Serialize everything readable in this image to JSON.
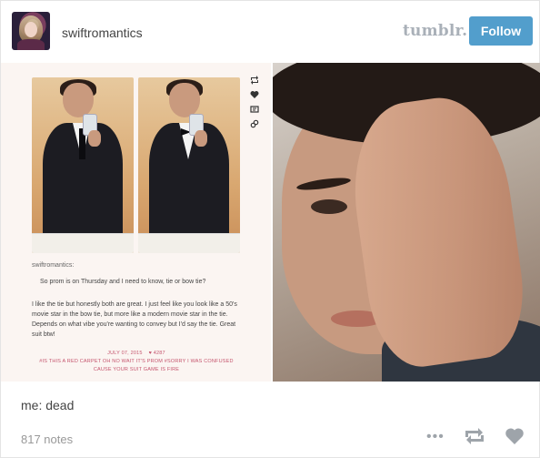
{
  "header": {
    "blog_name": "swiftromantics",
    "logo_text": "tumblr.",
    "follow_label": "Follow"
  },
  "embedded_post": {
    "side_icons": [
      "reblog-icon",
      "heart-icon",
      "comment-icon",
      "link-icon"
    ],
    "blog_name": "swiftromantics:",
    "question": "So prom is on Thursday and I need to know, tie or bow tie?",
    "answer": "I like the tie but honestly both are great. I just feel like you look like a 50's movie star in the bow tie, but more like a modern movie star in the tie. Depends on what vibe you're wanting to convey but I'd say the tie. Great suit btw!",
    "date": "JULY 07, 2015",
    "notes": "♥ 4287",
    "tags": "#IS THIS A RED CARPET OH NO WAIT IT'S PROM   #SORRY I WAS CONFUSED CAUSE YOUR SUIT GAME IS FIRE"
  },
  "caption": "me: dead",
  "footer": {
    "notes": "817 notes",
    "more": "•••"
  },
  "colors": {
    "follow_bg": "#529ecc",
    "tag_pink": "#c5546d",
    "icon_gray": "#9ea4aa"
  }
}
